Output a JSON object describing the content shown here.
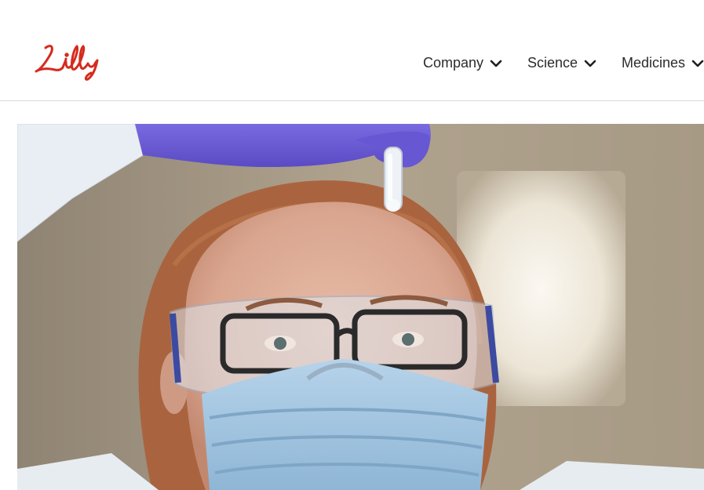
{
  "brand": {
    "name": "Lilly",
    "color": "#d52b1e"
  },
  "nav": {
    "items": [
      {
        "label": "Company",
        "icon": "chevron-down-icon"
      },
      {
        "label": "Science",
        "icon": "chevron-down-icon"
      },
      {
        "label": "Medicines",
        "icon": "chevron-down-icon"
      }
    ]
  },
  "hero": {
    "image": "scientist-in-lab-holding-vial",
    "colors": {
      "background": "#a89a86",
      "glove": "#6b5bd6",
      "mask": "#a9cbe4",
      "goggles": "#3c4aa0"
    }
  }
}
